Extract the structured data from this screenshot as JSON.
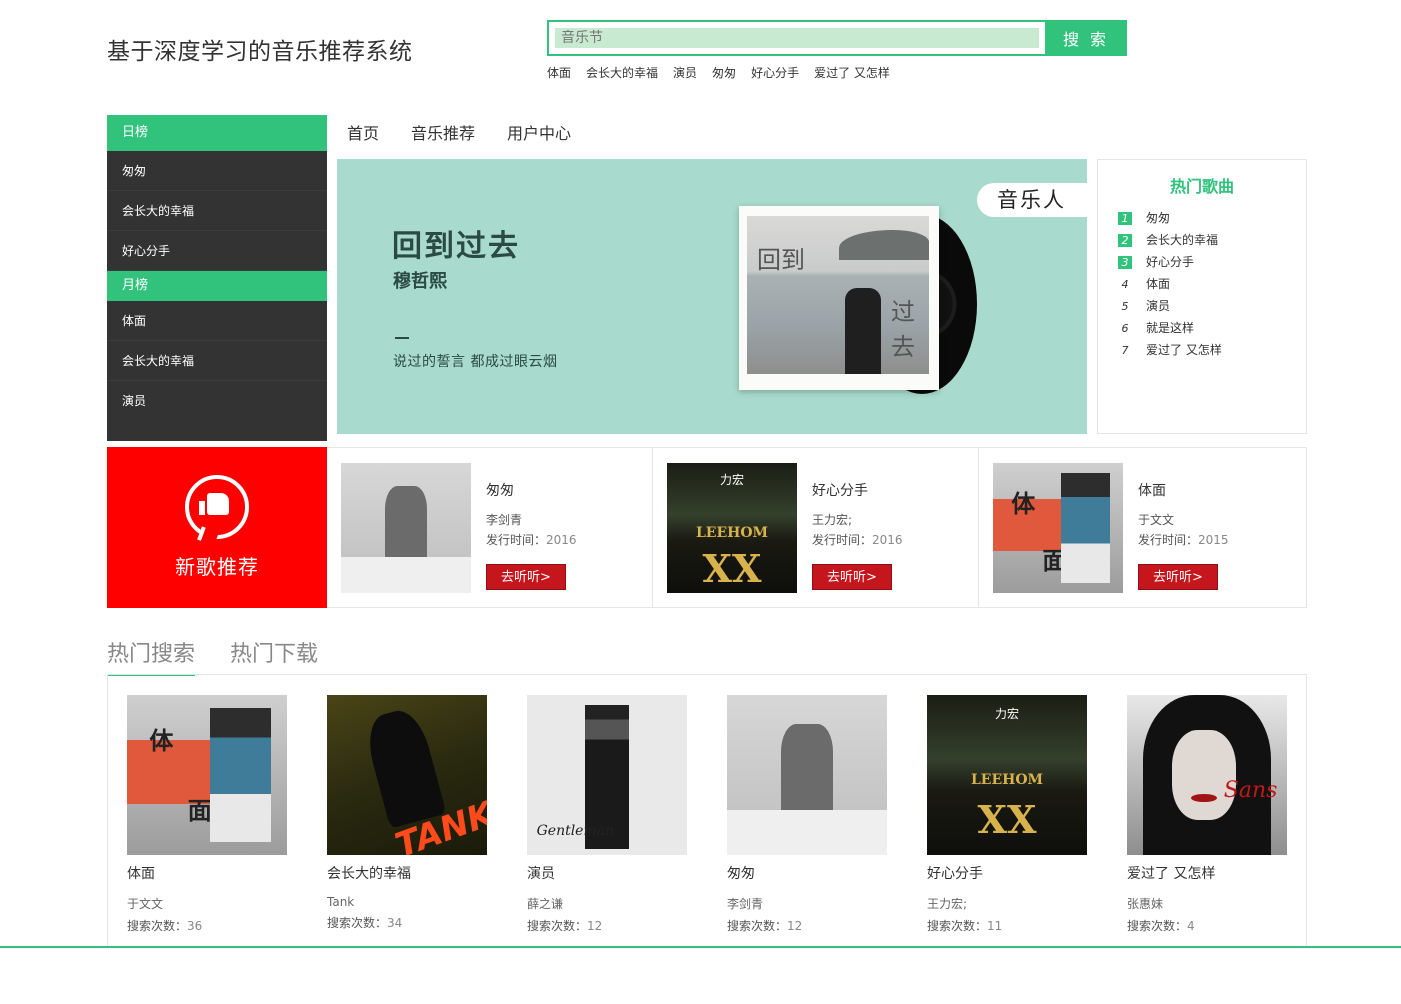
{
  "header": {
    "site_title": "基于深度学习的音乐推荐系统",
    "search_placeholder": "音乐节",
    "search_button": "搜 索",
    "hot_words": [
      "体面",
      "会长大的幸福",
      "演员",
      "匆匆",
      "好心分手",
      "爱过了 又怎样"
    ]
  },
  "sidebar": {
    "daily_label": "日榜",
    "daily_items": [
      "匆匆",
      "会长大的幸福",
      "好心分手"
    ],
    "monthly_label": "月榜",
    "monthly_items": [
      "体面",
      "会长大的幸福",
      "演员"
    ]
  },
  "nav": {
    "items": [
      "首页",
      "音乐推荐",
      "用户中心"
    ]
  },
  "banner": {
    "title": "回到过去",
    "artist": "穆哲熙",
    "quote": "说过的誓言 都成过眼云烟",
    "tag": "音乐人",
    "cover_text_1": "回到",
    "cover_text_2": "过去",
    "bg_color": "#a8dbcd"
  },
  "hot_songs": {
    "title": "热门歌曲",
    "items": [
      {
        "rank": "1",
        "name": "匆匆"
      },
      {
        "rank": "2",
        "name": "会长大的幸福"
      },
      {
        "rank": "3",
        "name": "好心分手"
      },
      {
        "rank": "4",
        "name": "体面"
      },
      {
        "rank": "5",
        "name": "演员"
      },
      {
        "rank": "6",
        "name": "就是这样"
      },
      {
        "rank": "7",
        "name": "爱过了 又怎样"
      }
    ]
  },
  "new_songs": {
    "tile_label": "新歌推荐",
    "date_label": "发行时间：",
    "listen_button": "去听听>",
    "items": [
      {
        "name": "匆匆",
        "artist": "李剑青",
        "date": "2016"
      },
      {
        "name": "好心分手",
        "artist": "王力宏;",
        "date": "2016"
      },
      {
        "name": "体面",
        "artist": "于文文",
        "date": "2015"
      }
    ]
  },
  "tabs": {
    "hot_search": "热门搜索",
    "hot_download": "热门下载"
  },
  "hot_search": {
    "count_label": "搜索次数：",
    "items": [
      {
        "name": "体面",
        "artist": "于文文",
        "count": "36"
      },
      {
        "name": "会长大的幸福",
        "artist": "Tank",
        "count": "34"
      },
      {
        "name": "演员",
        "artist": "薛之谦",
        "count": "12"
      },
      {
        "name": "匆匆",
        "artist": "李剑青",
        "count": "12"
      },
      {
        "name": "好心分手",
        "artist": "王力宏;",
        "count": "11"
      },
      {
        "name": "爱过了 又怎样",
        "artist": "张惠妹",
        "count": "4"
      }
    ]
  },
  "covers": {
    "leehom_brand": "LEEHOM",
    "leehom_xx": "XX",
    "leehom_cn": "力宏",
    "tank_word": "TANK",
    "gent_sig": "Gentleman",
    "selina_sig": "Sans",
    "timian_1": "体",
    "timian_2": "面"
  },
  "colors": {
    "accent": "#31c27c",
    "sidebar_bg": "#333333",
    "new_tile": "#ff0000",
    "listen_button": "#c4161c"
  }
}
